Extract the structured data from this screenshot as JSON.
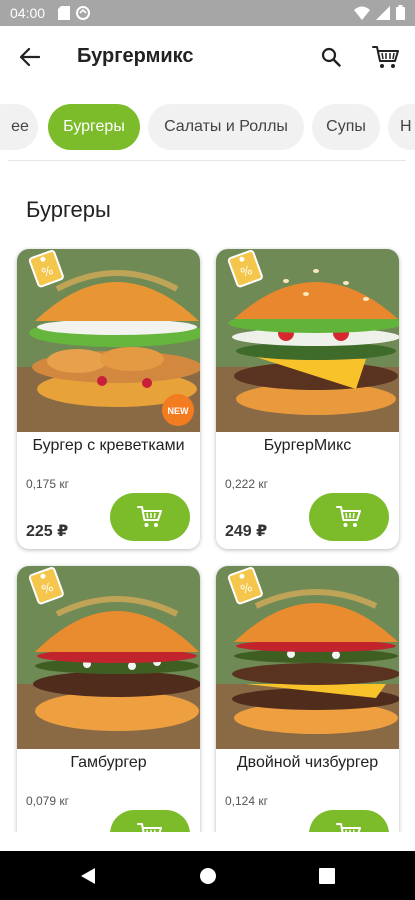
{
  "status_bar": {
    "time": "04:00",
    "left_icons": [
      "sd-card-icon",
      "sync-icon"
    ],
    "right_icons": [
      "wifi-icon",
      "signal-icon",
      "battery-icon"
    ]
  },
  "app_bar": {
    "title": "Бургермикс",
    "back_icon": "arrow-left-icon",
    "search_icon": "search-icon",
    "cart_icon": "shopping-cart-icon"
  },
  "categories": {
    "active_index": 1,
    "items": [
      {
        "label": "ее"
      },
      {
        "label": "Бургеры"
      },
      {
        "label": "Салаты и Роллы"
      },
      {
        "label": "Супы"
      },
      {
        "label": "Н"
      }
    ]
  },
  "section": {
    "title": "Бургеры"
  },
  "currency": "₽",
  "products": [
    {
      "name": "Бургер с креветками",
      "weight": "0,175 кг",
      "price": "225 ₽",
      "badge": "NEW",
      "type": "shrimp"
    },
    {
      "name": "БургерМикс",
      "weight": "0,222 кг",
      "price": "249 ₽",
      "badge": "",
      "type": "big"
    },
    {
      "name": "Гамбургер",
      "weight": "0,079 кг",
      "price": "",
      "badge": "",
      "type": "hamburger"
    },
    {
      "name": "Двойной чизбургер",
      "weight": "0,124 кг",
      "price": "",
      "badge": "",
      "type": "double"
    }
  ],
  "colors": {
    "accent": "#7cbb2a",
    "status_bar": "#a6a6a6",
    "nav_bar": "#000000",
    "new_badge": "#f47c20"
  },
  "nav_bar": {
    "icons": [
      "back-triangle-icon",
      "home-circle-icon",
      "recents-square-icon"
    ]
  }
}
